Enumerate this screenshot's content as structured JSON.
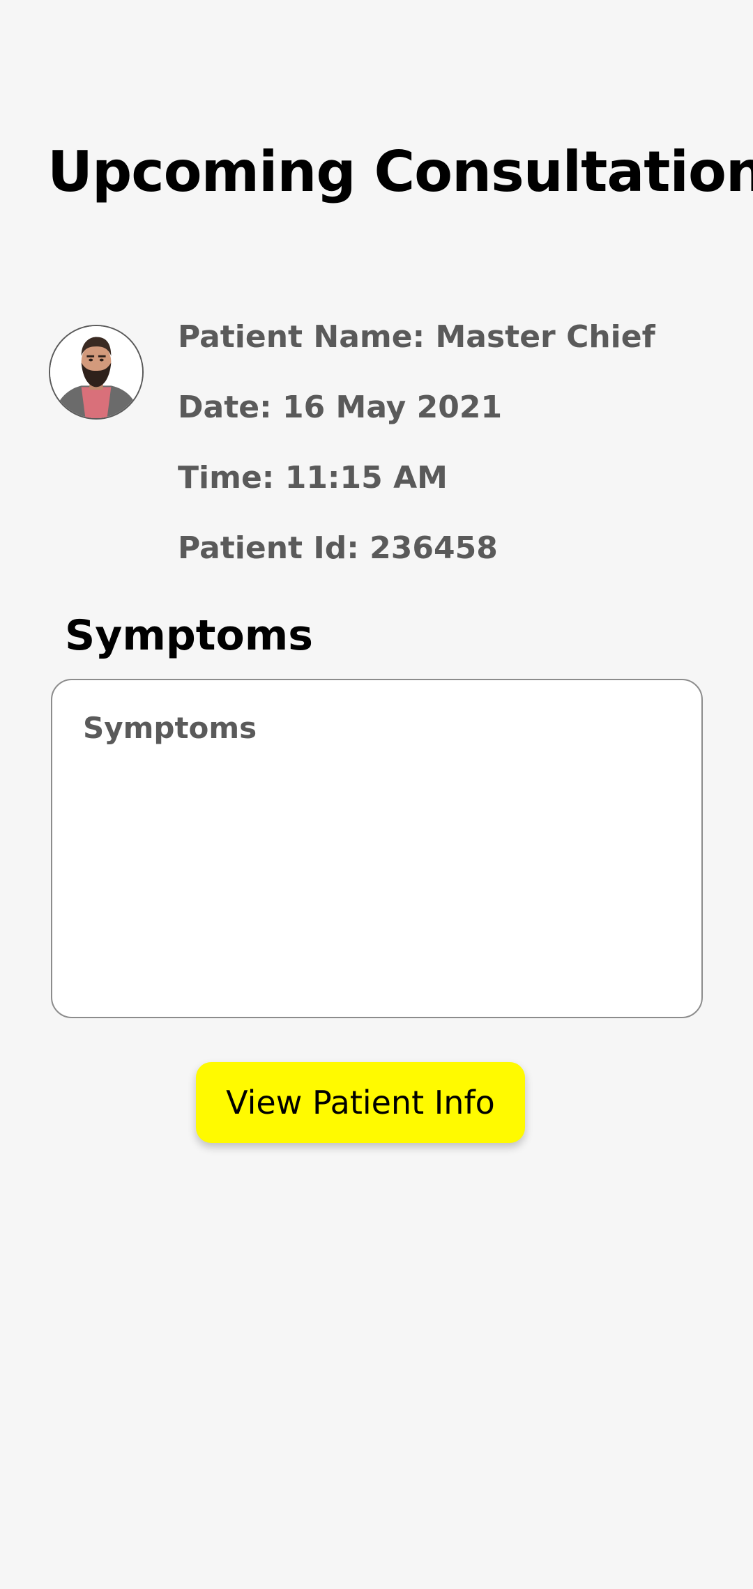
{
  "page": {
    "title": "Upcoming Consultation"
  },
  "patient": {
    "name_line": "Patient Name: Master Chief",
    "date_line": "Date: 16 May 2021",
    "time_line": "Time: 11:15 AM",
    "id_line": "Patient Id: 236458"
  },
  "symptoms": {
    "heading": "Symptoms",
    "placeholder": "Symptoms",
    "value": ""
  },
  "actions": {
    "view_patient_info_label": "View Patient Info"
  },
  "colors": {
    "background": "#f6f6f6",
    "button": "#fffa00",
    "secondary_text": "#5a5a5a"
  }
}
